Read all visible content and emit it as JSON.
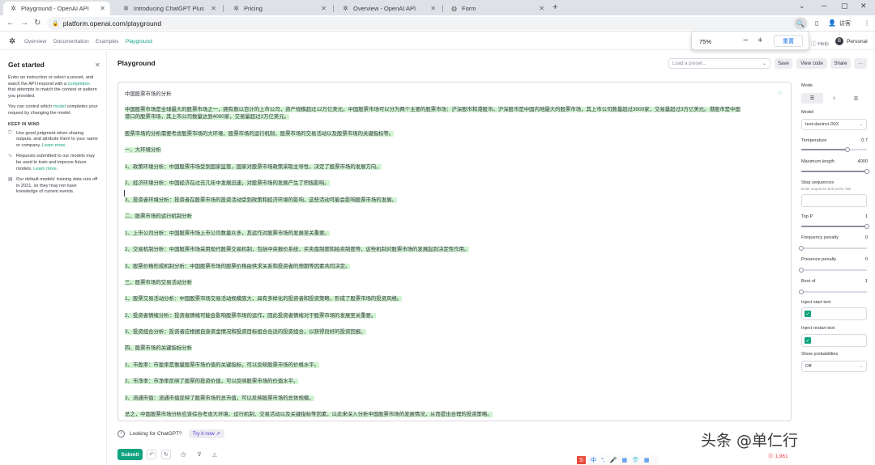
{
  "browser": {
    "tabs": [
      {
        "label": "Playground - OpenAI API",
        "left": 0
      },
      {
        "label": "Introducing ChatGPT Plus"
      },
      {
        "label": "Pricing"
      },
      {
        "label": "Overview - OpenAI API"
      },
      {
        "label": "Form"
      }
    ],
    "url": "platform.openai.com/playground",
    "profile_label": "访客"
  },
  "zoom": {
    "value": "75%",
    "reset_label": "重置"
  },
  "header": {
    "nav": [
      "Overview",
      "Documentation",
      "Examples",
      "Playground"
    ],
    "help": "Help",
    "avatar_letter": "B",
    "personal": "Personal"
  },
  "sidebar": {
    "title": "Get started",
    "intro_pre": "Enter an instruction or select a preset, and watch the API respond with a ",
    "intro_link": "completion",
    "intro_post": " that attempts to match the context or pattern you provided.",
    "control_pre": "You can control which ",
    "control_link": "model",
    "control_post": " completes your request by changing the model.",
    "keep_heading": "KEEP IN MIND",
    "bullets": [
      {
        "text": "Use good judgment when sharing outputs, and attribute them to your name or company. ",
        "link": "Learn more."
      },
      {
        "text": "Requests submitted to our models may be used to train and improve future models. ",
        "link": "Learn more."
      },
      {
        "text": "Our default models' training data cuts off in 2021, so they may not have knowledge of current events.",
        "link": ""
      }
    ]
  },
  "main": {
    "title": "Playground",
    "preset_placeholder": "Load a preset...",
    "save": "Save",
    "view_code": "View code",
    "share": "Share",
    "more": "···",
    "prompt": "中国股票市场的分析",
    "lines": [
      "中国股票市场是全球最大的股票市场之一，拥有数以百计的上市公司，资产规模超过12万亿美元。中国股票市场可以分为两个主要的股票市场：沪深股市和港股市。沪深股市是中国内地最大的股票市场，其上市公司数量超过3000家，交易量超过3万亿美元。港股市是中国",
      "港口的股票市场，其上市公司数量达到4000家，交易量超过2万亿美元。",
      "股票市场的分析需要考虑股票市场的大环境、股票市场的运行机制、股票市场的交易活动以及股票市场的关键指标等。",
      "一、大环境分析",
      "1、政策环境分析：中国股票市场受到国家监管，国家对股票市场政策采取主导性，决定了股票市场的发展方向。",
      "2、经济环境分析：中国经济在过去几年中发展迅速，对股票市场的发展产生了积极影响。",
      "3、投资者环境分析：投资者在股票市场的投资活动受到政策和经济环境的影响，这些活动可能会影响股票市场的发展。",
      "二、股票市场的运行机制分析",
      "1、上市公司分析：中国股票市场上市公司数量众多，其运作对股票市场的发展至关重要。",
      "2、交易机制分析：中国股票市场采用现代股票交易机制，包括中央报价系统、买卖盘制度和拍卖制度等，这些机制对股票市场的发展起到决定性作用。",
      "3、股票价格形成机制分析：中国股票市场的股票价格由供求关系和投资者的预期等因素共同决定。",
      "三、股票市场的交易活动分析",
      "1、股票交易活动分析：中国股票市场交易活动规模庞大，具有多样化的投资者和投资策略，形成了股票市场的投资风格。",
      "2、投资者情绪分析：投资者情绪可能会影响股票市场的运作，因此投资者情绪对于股票市场的发展至关重要。",
      "3、投资组合分析：投资者应根据自身资金情况和投资目标组合合适的投资组合，以获得良好的投资回报。",
      "四、股票市场的关键指标分析",
      "1、市盈率：市盈率是衡量股票市场价值的关键指标，可以反映股票市场的价格水平。",
      "2、市净率：市净率反映了股票的投资价值，可以反映股票市场的价值水平。",
      "3、流通市值：流通市值反映了股票市场的总市值，可以反映股票市场的总体规模。",
      "总之，中国股票市场分析应该综合考虑大环境、运行机制、交易活动以及关键指标等因素，以此来深入分析中国股票市场的发展情况，从而提出合理的投资策略。"
    ],
    "looking": "Looking for ChatGPT?",
    "try_it": "Try it now",
    "submit": "Submit",
    "token_count": "1,961",
    "watermark": "头条 @单仁行",
    "ime": [
      "中",
      "°,",
      "🎤",
      "▦",
      "👕",
      "▦"
    ]
  },
  "panel": {
    "mode_label": "Mode",
    "model_label": "Model",
    "model_value": "text-davinci-003",
    "temperature_label": "Temperature",
    "temperature_value": "0.7",
    "temperature_frac": 0.7,
    "max_length_label": "Maximum length",
    "max_length_value": "4000",
    "max_length_frac": 1.0,
    "stop_label": "Stop sequences",
    "stop_sub": "Enter sequence and press Tab",
    "topp_label": "Top P",
    "topp_value": "1",
    "topp_frac": 1.0,
    "freq_label": "Frequency penalty",
    "freq_value": "0",
    "freq_frac": 0,
    "presence_label": "Presence penalty",
    "presence_value": "0",
    "presence_frac": 0,
    "bestof_label": "Best of",
    "bestof_value": "1",
    "bestof_frac": 0,
    "inject_start_label": "Inject start text",
    "inject_restart_label": "Inject restart text",
    "show_prob_label": "Show probabilities",
    "show_prob_value": "Off"
  }
}
